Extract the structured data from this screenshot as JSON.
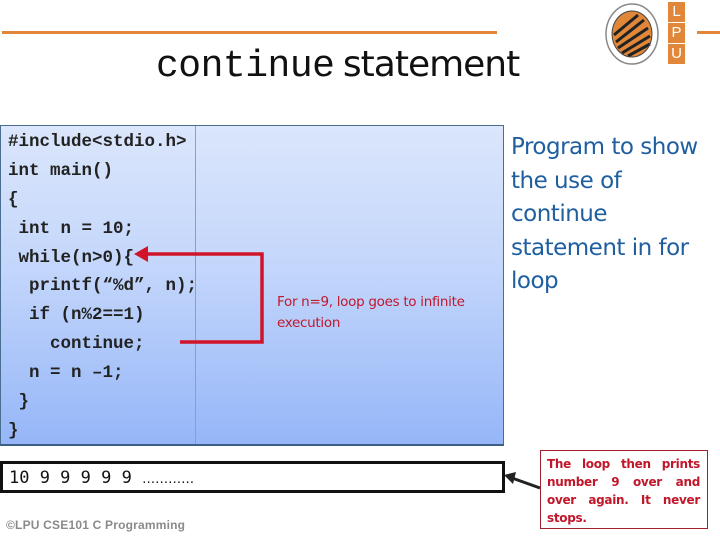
{
  "slide": {
    "title_code": "continue",
    "title_word": "statement",
    "logo": {
      "letters": [
        "L",
        "P",
        "U"
      ],
      "seal_icon": "university-seal-icon",
      "accent_color": "#e0873a"
    },
    "code": {
      "lines": [
        "#include<stdio.h>",
        "int main()",
        "{",
        " int n = 10;",
        " while(n>0){",
        "  printf(“%d”, n);",
        "  if (n%2==1)",
        "    continue;",
        "  n = n –1;",
        " }",
        "}"
      ]
    },
    "annotation": "For n=9, loop goes to infinite execution",
    "side_caption": "Program to show the use of continue statement in for loop",
    "output": {
      "values": "10 9 9 9 9 9",
      "ellipsis": "…………"
    },
    "note": "The loop then prints number 9 over and over again. It never stops.",
    "footer": "©LPU CSE101 C Programming",
    "colors": {
      "arrow": "#d0152a",
      "caption": "#1f5fa0",
      "annotation": "#c0172b"
    }
  }
}
